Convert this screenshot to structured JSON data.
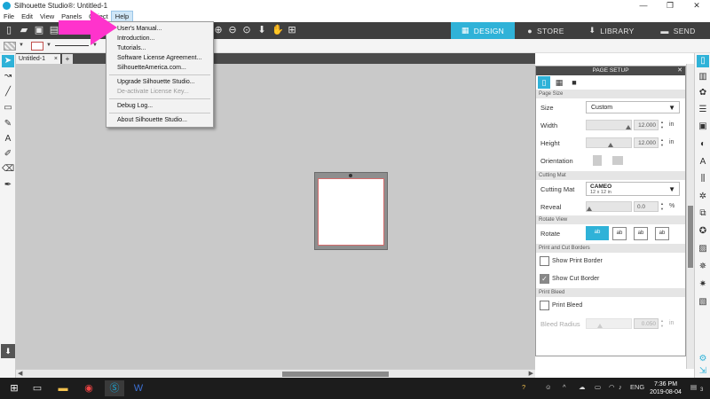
{
  "window": {
    "title": "Silhouette Studio®: Untitled-1",
    "controls": {
      "minimize": "—",
      "maximize": "❐",
      "close": "✕"
    }
  },
  "menubar": {
    "items": [
      "File",
      "Edit",
      "View",
      "Panels",
      "Object",
      "Help"
    ],
    "active": "Help"
  },
  "help_menu": {
    "items": [
      {
        "label": "User's Manual...",
        "enabled": true
      },
      {
        "label": "Introduction...",
        "enabled": true
      },
      {
        "label": "Tutorials...",
        "enabled": true
      },
      {
        "label": "Software License Agreement...",
        "enabled": true
      },
      {
        "label": "SilhouetteAmerica.com...",
        "enabled": true
      },
      {
        "label": "Upgrade Silhouette Studio...",
        "enabled": true
      },
      {
        "label": "De-activate License Key...",
        "enabled": false
      },
      {
        "label": "Debug Log...",
        "enabled": true
      },
      {
        "label": "About Silhouette Studio...",
        "enabled": true
      }
    ]
  },
  "top_tabs": [
    {
      "label": "DESIGN",
      "icon": "grid-icon",
      "active": true
    },
    {
      "label": "STORE",
      "icon": "store-icon",
      "active": false
    },
    {
      "label": "LIBRARY",
      "icon": "library-icon",
      "active": false
    },
    {
      "label": "SEND",
      "icon": "send-icon",
      "active": false
    }
  ],
  "document_tab": {
    "label": "Untitled-1",
    "close": "×",
    "add": "+"
  },
  "page_setup": {
    "title": "PAGE SETUP",
    "sections": {
      "page_size": "Page Size",
      "cutting_mat": "Cutting Mat",
      "rotate_view": "Rotate View",
      "print_cut_borders": "Print and Cut Borders",
      "print_bleed": "Print Bleed"
    },
    "size": {
      "label": "Size",
      "value": "Custom"
    },
    "width": {
      "label": "Width",
      "value": "12.000",
      "unit": "in"
    },
    "height": {
      "label": "Height",
      "value": "12.000",
      "unit": "in"
    },
    "orientation": {
      "label": "Orientation"
    },
    "cutting_mat": {
      "label": "Cutting Mat",
      "name": "CAMEO",
      "size": "12 x 12 in"
    },
    "reveal": {
      "label": "Reveal",
      "value": "0.0",
      "unit": "%"
    },
    "rotate": {
      "label": "Rotate",
      "options": [
        "ab",
        "ab",
        "ab",
        "ab"
      ]
    },
    "show_print_border": {
      "label": "Show Print Border",
      "checked": false
    },
    "show_cut_border": {
      "label": "Show Cut Border",
      "checked": true
    },
    "print_bleed": {
      "label": "Print Bleed",
      "checked": false
    },
    "bleed_radius": {
      "label": "Bleed Radius",
      "value": "0.050",
      "unit": "in"
    }
  },
  "taskbar": {
    "language": "ENG",
    "time": "7:36 PM",
    "date": "2019-08-04",
    "notifications": "3"
  },
  "colors": {
    "accent": "#2fb2d8",
    "toolbar": "#3f3f3f",
    "canvas": "#c9c9c9",
    "annotation_arrow": "#ff33cc"
  }
}
